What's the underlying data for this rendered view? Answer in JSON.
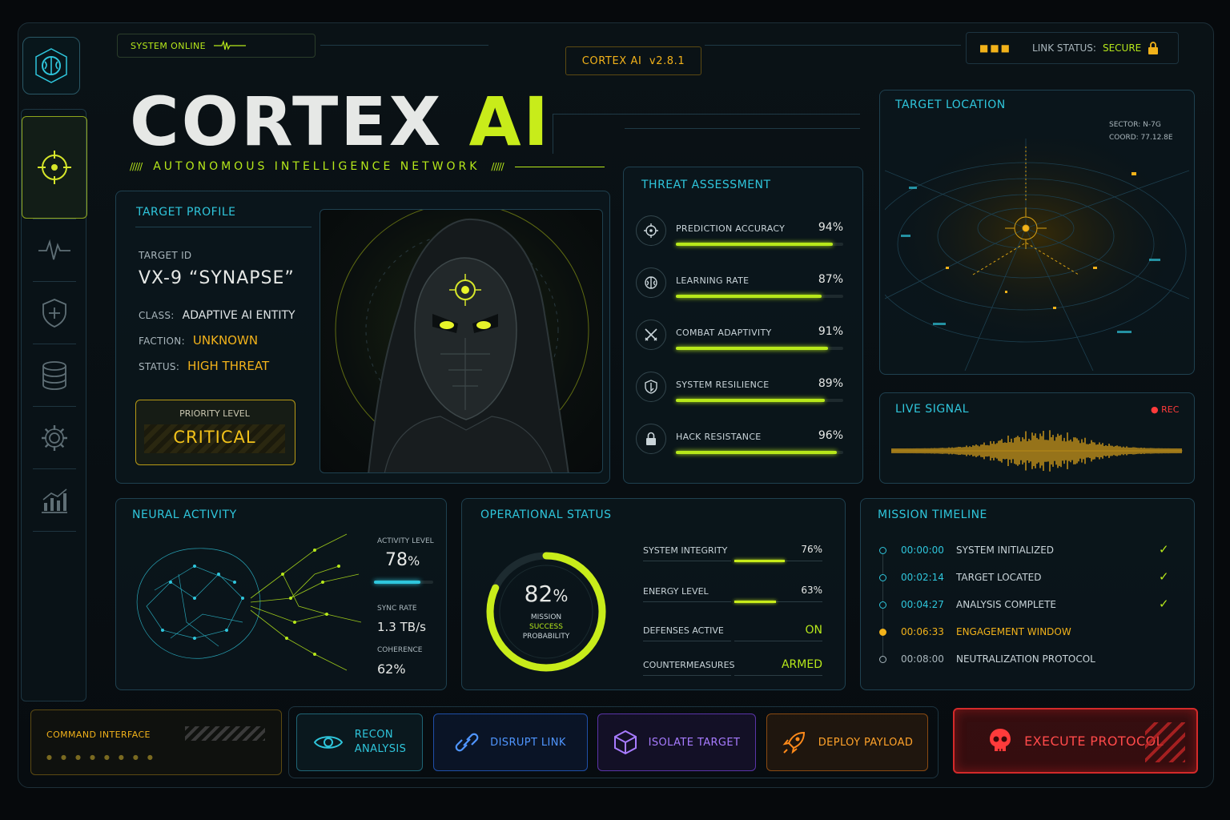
{
  "header": {
    "system_status": "SYSTEM ONLINE",
    "version": "CORTEX AI  v2.8.1",
    "link_status_label": "LINK STATUS:",
    "link_status_value": "SECURE"
  },
  "brand": {
    "title_main": "CORTEX",
    "title_accent": "AI",
    "subtitle": "AUTONOMOUS INTELLIGENCE NETWORK"
  },
  "target_profile": {
    "title": "TARGET PROFILE",
    "id_label": "TARGET ID",
    "id_value": "VX-9 “SYNAPSE”",
    "class_label": "CLASS:",
    "class_value": "ADAPTIVE AI ENTITY",
    "faction_label": "FACTION:",
    "faction_value": "UNKNOWN",
    "status_label": "STATUS:",
    "status_value": "HIGH THREAT",
    "priority_label": "PRIORITY LEVEL",
    "priority_value": "CRITICAL"
  },
  "threat_assessment": {
    "title": "THREAT ASSESSMENT",
    "items": [
      {
        "label": "PREDICTION ACCURACY",
        "value_text": "94%",
        "value": 0.94,
        "icon": "crosshair-icon"
      },
      {
        "label": "LEARNING RATE",
        "value_text": "87%",
        "value": 0.87,
        "icon": "brain-icon"
      },
      {
        "label": "COMBAT ADAPTIVITY",
        "value_text": "91%",
        "value": 0.91,
        "icon": "swords-icon"
      },
      {
        "label": "SYSTEM RESILIENCE",
        "value_text": "89%",
        "value": 0.89,
        "icon": "shield-icon"
      },
      {
        "label": "HACK RESISTANCE",
        "value_text": "96%",
        "value": 0.96,
        "icon": "lock-icon"
      }
    ]
  },
  "target_location": {
    "title": "TARGET LOCATION",
    "sector": "SECTOR: N-7G",
    "coord": "COORD: 77.12.8E"
  },
  "live_signal": {
    "title": "LIVE SIGNAL",
    "rec": "● REC"
  },
  "neural_activity": {
    "title": "NEURAL ACTIVITY",
    "activity_label": "ACTIVITY LEVEL",
    "activity_value": "78",
    "activity_unit": "%",
    "activity_fraction": 0.78,
    "sync_label": "SYNC RATE",
    "sync_value": "1.3 TB/s",
    "coherence_label": "COHERENCE",
    "coherence_value": "62%"
  },
  "operational_status": {
    "title": "OPERATIONAL STATUS",
    "gauge_value": "82",
    "gauge_unit": "%",
    "gauge_fraction": 0.82,
    "gauge_line1": "MISSION",
    "gauge_line2": "SUCCESS",
    "gauge_line3": "PROBABILITY",
    "rows": [
      {
        "label": "SYSTEM INTEGRITY",
        "value": "76%",
        "fraction": 0.76
      },
      {
        "label": "ENERGY LEVEL",
        "value": "63%",
        "fraction": 0.63
      },
      {
        "label": "DEFENSES ACTIVE",
        "value": "ON"
      },
      {
        "label": "COUNTERMEASURES",
        "value": "ARMED"
      }
    ]
  },
  "mission_timeline": {
    "title": "MISSION TIMELINE",
    "events": [
      {
        "time": "00:00:00",
        "label": "SYSTEM INITIALIZED",
        "state": "done",
        "check": "✓"
      },
      {
        "time": "00:02:14",
        "label": "TARGET LOCATED",
        "state": "done",
        "check": "✓"
      },
      {
        "time": "00:04:27",
        "label": "ANALYSIS COMPLETE",
        "state": "done",
        "check": "✓"
      },
      {
        "time": "00:06:33",
        "label": "ENGAGEMENT WINDOW",
        "state": "active",
        "check": ""
      },
      {
        "time": "00:08:00",
        "label": "NEUTRALIZATION PROTOCOL",
        "state": "pending",
        "check": ""
      }
    ]
  },
  "command": {
    "title": "COMMAND INTERFACE",
    "buttons": {
      "recon_line1": "RECON",
      "recon_line2": "ANALYSIS",
      "disrupt": "DISRUPT LINK",
      "isolate": "ISOLATE TARGET",
      "deploy": "DEPLOY PAYLOAD",
      "execute": "EXECUTE PROTOCOL"
    }
  },
  "colors": {
    "lime": "#b7e81a",
    "cyan": "#2fc6dc",
    "amber": "#f2b21a",
    "red": "#ff3b3b",
    "blue": "#2f7cff",
    "purple": "#9b5cff",
    "orange": "#ff8a1a"
  }
}
